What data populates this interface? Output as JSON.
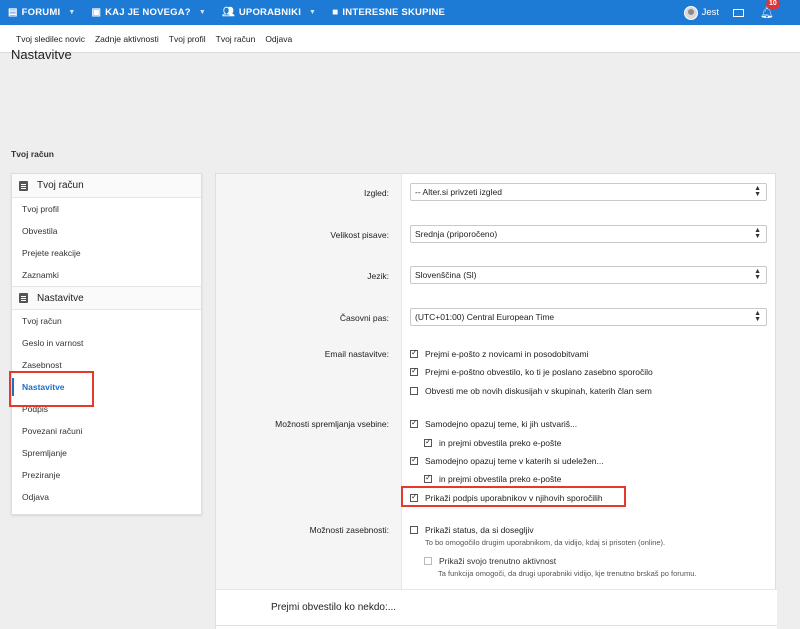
{
  "topnav": {
    "items": [
      {
        "label": "FORUMI",
        "icon": "forum-icon"
      },
      {
        "label": "KAJ JE NOVEGA?",
        "icon": "chat-icon"
      },
      {
        "label": "UPORABNIKI",
        "icon": "users-icon"
      },
      {
        "label": "INTERESNE SKUPINE",
        "icon": "folder-icon"
      }
    ],
    "user_name": "Jest",
    "notification_count": "10",
    "color": "#1d7ad5"
  },
  "subnav": {
    "items": [
      "Tvoj sledilec novic",
      "Zadnje aktivnosti",
      "Tvoj profil",
      "Tvoj račun",
      "Odjava"
    ]
  },
  "page_title": "Nastavitve",
  "section_label": "Tvoj račun",
  "sidebar": {
    "group1_title": "Tvoj račun",
    "group1_items": [
      "Tvoj profil",
      "Obvestila",
      "Prejete reakcije",
      "Zaznamki"
    ],
    "group2_title": "Nastavitve",
    "group2_items": [
      "Tvoj račun",
      "Geslo in varnost",
      "Zasebnost",
      "Nastavitve",
      "Podpis",
      "Povezani računi",
      "Spremljanje",
      "Preziranje",
      "Odjava"
    ],
    "active_item": "Nastavitve"
  },
  "form": {
    "style_label": "Izgled:",
    "style_value": "-- Alter.si privzeti izgled",
    "fontsize_label": "Velikost pisave:",
    "fontsize_value": "Srednja (priporočeno)",
    "language_label": "Jezik:",
    "language_value": "Slovenščina (Sl)",
    "timezone_label": "Časovni pas:",
    "timezone_value": "(UTC+01:00) Central European Time",
    "email_label": "Email nastavitve:",
    "email_options": [
      {
        "label": "Prejmi e-pošto z novicami in posodobitvami",
        "checked": true
      },
      {
        "label": "Prejmi e-poštno obvestilo, ko ti je poslano zasebno sporočilo",
        "checked": true
      },
      {
        "label": "Obvesti me ob novih diskusijah v skupinah, katerih član sem",
        "checked": false
      }
    ],
    "content_label": "Možnosti spremljanja vsebine:",
    "content_options": [
      {
        "label": "Samodejno opazuj teme, ki jih ustvariš...",
        "checked": true
      },
      {
        "label": "in prejmi obvestila preko e-pošte",
        "checked": true
      },
      {
        "label": "Samodejno opazuj teme v katerih si udeležen...",
        "checked": true
      },
      {
        "label": "in prejmi obvestila preko e-pošte",
        "checked": true
      },
      {
        "label": "Prikaži podpis uporabnikov v njihovih sporočilih",
        "checked": true
      }
    ],
    "privacy_label": "Možnosti zasebnosti:",
    "privacy_options": [
      {
        "label": "Prikaži status, da si dosegljiv",
        "checked": false,
        "hint": "To bo omogočilo drugim uporabnikom, da vidijo, kdaj si prisoten (online)."
      },
      {
        "label": "Prikaži svojo trenutno aktivnost",
        "checked": false,
        "hint": "Ta funkcija omogoči, da drugi uporabniki vidijo, kje trenutno brskaš po forumu."
      }
    ],
    "notify_label": "Prejmi obvestilo ko nekdo:..."
  }
}
